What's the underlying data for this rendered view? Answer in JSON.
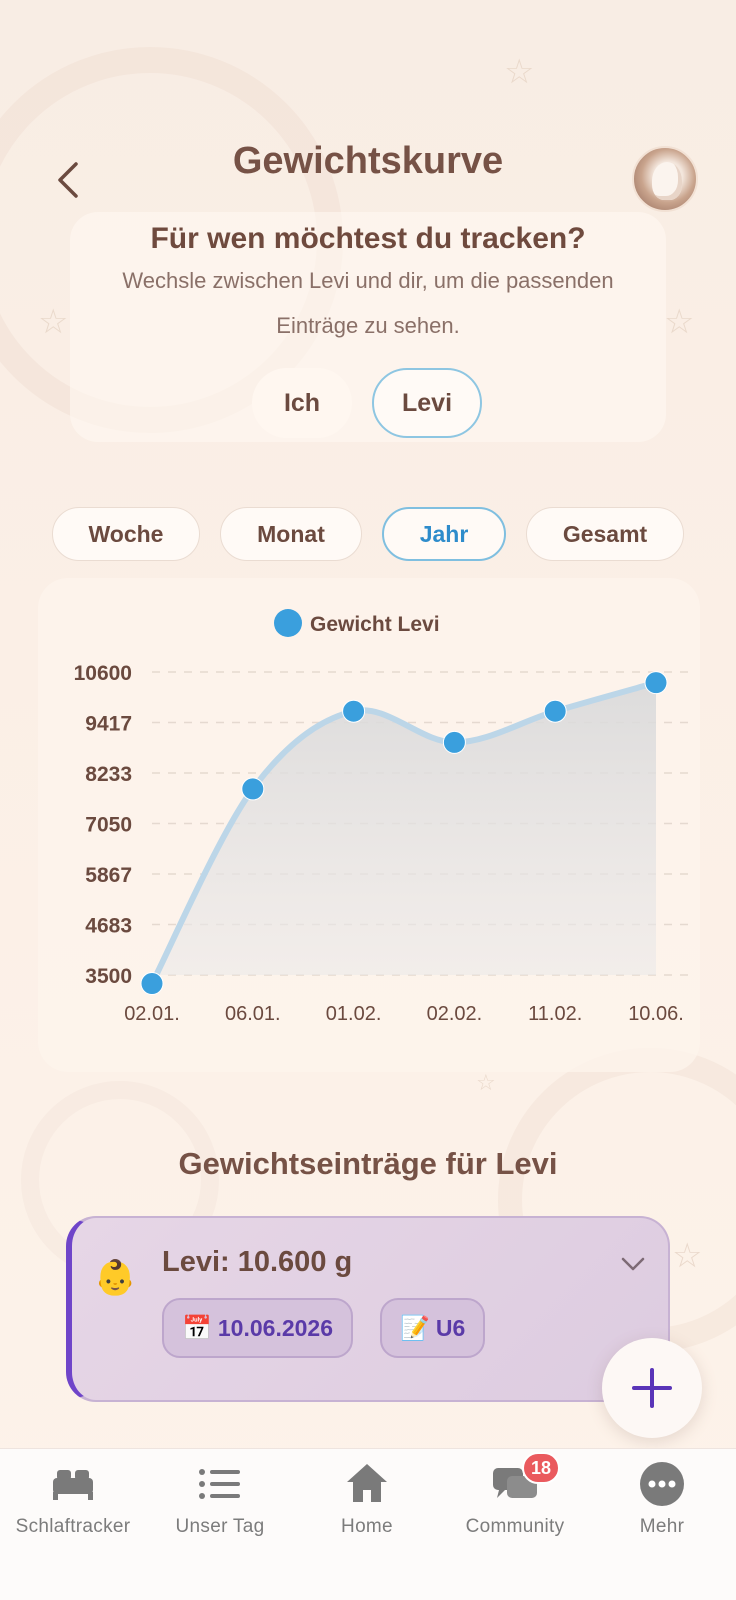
{
  "header": {
    "title": "Gewichtskurve"
  },
  "tracker": {
    "question": "Für wen möchtest du tracken?",
    "subtitle": "Wechsle zwischen Levi und dir, um die passenden Einträge zu sehen.",
    "options": [
      "Ich",
      "Levi"
    ],
    "selected": "Levi"
  },
  "ranges": {
    "options": [
      "Woche",
      "Monat",
      "Jahr",
      "Gesamt"
    ],
    "selected": "Jahr"
  },
  "chart_data": {
    "type": "area",
    "legend": "Gewicht Levi",
    "legend_color": "#3a9fdd",
    "series_color": "#3a9fdd",
    "categories": [
      "02.01.",
      "06.01.",
      "01.02.",
      "02.02.",
      "11.02.",
      "10.06."
    ],
    "values": [
      3300,
      7860,
      9680,
      8950,
      9680,
      10350
    ],
    "yticks": [
      "10600",
      "9417",
      "8233",
      "7050",
      "5867",
      "4683",
      "3500"
    ],
    "ylim": [
      3500,
      10600
    ],
    "grid": true
  },
  "entries": {
    "title": "Gewichtseinträge für Levi",
    "items": [
      {
        "emoji": "👶",
        "title": "Levi: 10.600 g",
        "date": "10.06.2026",
        "date_icon": "📅",
        "note": "U6",
        "note_icon": "📝"
      }
    ]
  },
  "tabbar": {
    "items": [
      {
        "label": "Schlaftracker",
        "icon": "bed-icon"
      },
      {
        "label": "Unser Tag",
        "icon": "list-icon"
      },
      {
        "label": "Home",
        "icon": "home-icon"
      },
      {
        "label": "Community",
        "icon": "chat-icon",
        "badge": "18"
      },
      {
        "label": "Mehr",
        "icon": "more-icon"
      }
    ]
  },
  "colors": {
    "accent": "#2e8ccb",
    "entry_accent": "#6f45c9",
    "badge": "#ea5a5e"
  }
}
